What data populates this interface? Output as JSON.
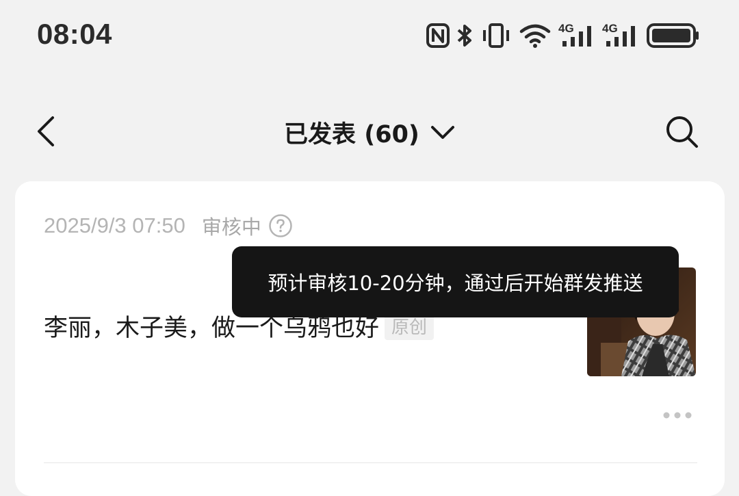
{
  "status_bar": {
    "time": "08:04",
    "icons": [
      "nfc-icon",
      "bluetooth-icon",
      "vibrate-icon",
      "wifi-icon",
      "signal-4g-icon",
      "signal-4g-icon",
      "battery-icon"
    ],
    "network_label_1": "4G",
    "network_label_2": "4G"
  },
  "header": {
    "title": "已发表 (60)",
    "back_icon": "chevron-left-icon",
    "dropdown_icon": "chevron-down-icon",
    "search_icon": "search-icon"
  },
  "article": {
    "date": "2025/9/3 07:50",
    "status": "审核中",
    "title": "李丽，木子美，做一个乌鸦也好",
    "tag": "原创",
    "more_icon": "more-dots-icon"
  },
  "tooltip": {
    "text": "预计审核10-20分钟，通过后开始群发推送"
  },
  "colors": {
    "background": "#f2f2f2",
    "card": "#ffffff",
    "tooltip": "#151515"
  }
}
